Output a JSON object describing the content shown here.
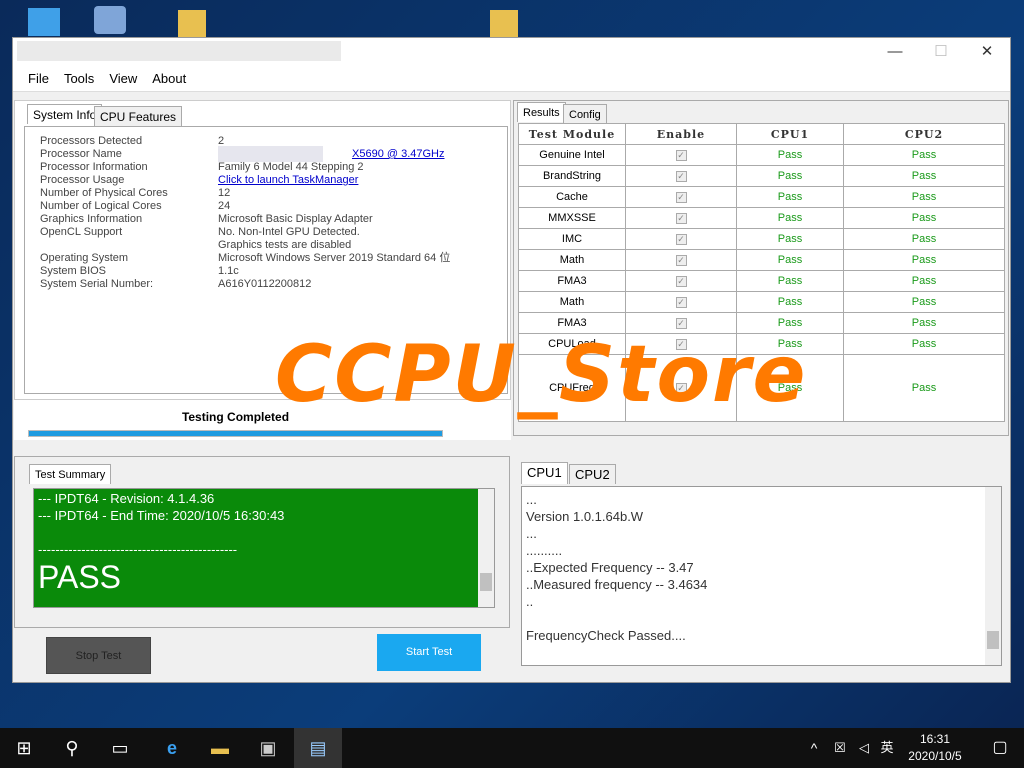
{
  "window": {
    "controls": {
      "minimize": "—",
      "maximize": "☐",
      "close": "✕"
    }
  },
  "menu": [
    "File",
    "Tools",
    "View",
    "About"
  ],
  "left_tabs": [
    "System Info",
    "CPU Features"
  ],
  "system_info": [
    {
      "label": "Processors Detected",
      "value": "2"
    },
    {
      "label": "Processor Name",
      "value": "X5690  @ 3.47GHz"
    },
    {
      "label": "Processor Information",
      "value": "Family 6 Model 44 Stepping 2"
    },
    {
      "label": "Processor Usage",
      "value": "Click to launch TaskManager"
    },
    {
      "label": "Number of Physical Cores",
      "value": "12"
    },
    {
      "label": "Number of Logical Cores",
      "value": "24"
    },
    {
      "label": "Graphics Information",
      "value": "Microsoft Basic Display Adapter"
    },
    {
      "label": "OpenCL Support",
      "value": "No. Non-Intel GPU Detected."
    },
    {
      "label": "",
      "value": "Graphics tests are disabled"
    },
    {
      "label": "Operating System",
      "value": "Microsoft Windows Server 2019 Standard 64 位"
    },
    {
      "label": "System BIOS",
      "value": "1.1c"
    },
    {
      "label": "System Serial Number:",
      "value": "A616Y0112200812"
    }
  ],
  "status": {
    "text": "Testing Completed",
    "progress": 100
  },
  "summary": {
    "tab": "Test Summary",
    "lines": [
      "--- IPDT64 - Revision: 4.1.4.36",
      "--- IPDT64 - End Time: 2020/10/5 16:30:43",
      "",
      "----------------------------------------------"
    ],
    "result": "PASS"
  },
  "buttons": {
    "stop": "Stop Test",
    "start": "Start Test"
  },
  "right_tabs": [
    "Results",
    "Config"
  ],
  "results": {
    "headers": [
      "Test Module",
      "Enable",
      "CPU1",
      "CPU2"
    ],
    "rows": [
      {
        "module": "Genuine Intel",
        "cpu1": "Pass",
        "cpu2": "Pass"
      },
      {
        "module": "BrandString",
        "cpu1": "Pass",
        "cpu2": "Pass"
      },
      {
        "module": "Cache",
        "cpu1": "Pass",
        "cpu2": "Pass"
      },
      {
        "module": "MMXSSE",
        "cpu1": "Pass",
        "cpu2": "Pass"
      },
      {
        "module": "IMC",
        "cpu1": "Pass",
        "cpu2": "Pass"
      },
      {
        "module": "Math",
        "cpu1": "Pass",
        "cpu2": "Pass"
      },
      {
        "module": "FMA3",
        "cpu1": "Pass",
        "cpu2": "Pass"
      },
      {
        "module": "Math",
        "cpu1": "Pass",
        "cpu2": "Pass"
      },
      {
        "module": "FMA3",
        "cpu1": "Pass",
        "cpu2": "Pass"
      },
      {
        "module": "CPULoad",
        "cpu1": "Pass",
        "cpu2": "Pass"
      },
      {
        "module": "CPUFreq",
        "cpu1": "Pass",
        "cpu2": "Pass"
      }
    ]
  },
  "cpu_tabs": [
    "CPU1",
    "CPU2"
  ],
  "cpu_log": [
    "...",
    "Version 1.0.1.64b.W",
    "...",
    "..........",
    "..Expected Frequency -- 3.47",
    "..Measured frequency -- 3.4634",
    "..",
    "",
    "FrequencyCheck Passed...."
  ],
  "watermark": "CCPU_Store",
  "taskbar": {
    "time": "16:31",
    "date": "2020/10/5",
    "ime": "英"
  }
}
